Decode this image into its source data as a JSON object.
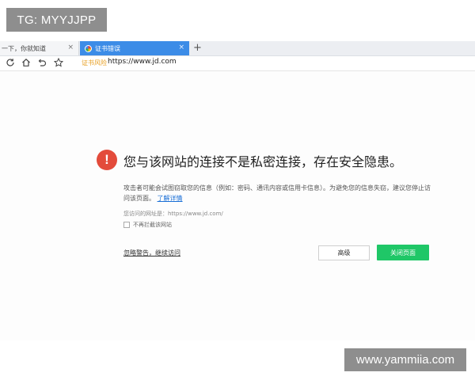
{
  "watermarks": {
    "top": "TG: MYYJJPP",
    "bottom": "www.yammiia.com"
  },
  "tabs": [
    {
      "label": "一下，你就知道",
      "close": "×",
      "active": false
    },
    {
      "label": "证书错误",
      "close": "×",
      "active": true
    }
  ],
  "new_tab": "+",
  "navbar": {
    "icons": [
      "refresh-icon",
      "home-icon",
      "undo-icon",
      "star-icon"
    ],
    "warning_label": "证书风险",
    "url": "https://www.jd.com"
  },
  "error": {
    "icon": "!",
    "title": "您与该网站的连接不是私密连接，存在安全隐患。",
    "description": "攻击者可能会试图窃取您的信息（例如：密码、通讯内容或信用卡信息）。为避免您的信息失窃，建议您停止访问该页面。",
    "details_link": "了解详情",
    "visited_url": "您访问的网址是：https://www.jd.com/",
    "checkbox_label": "不再拦截该网站",
    "ignore_link": "忽略警告，继续访问",
    "advanced_button": "高级",
    "close_button": "关闭页面"
  },
  "colors": {
    "accent": "#3c8ce7",
    "danger": "#e34b3b",
    "success": "#1fc767",
    "warning": "#e8a024"
  }
}
